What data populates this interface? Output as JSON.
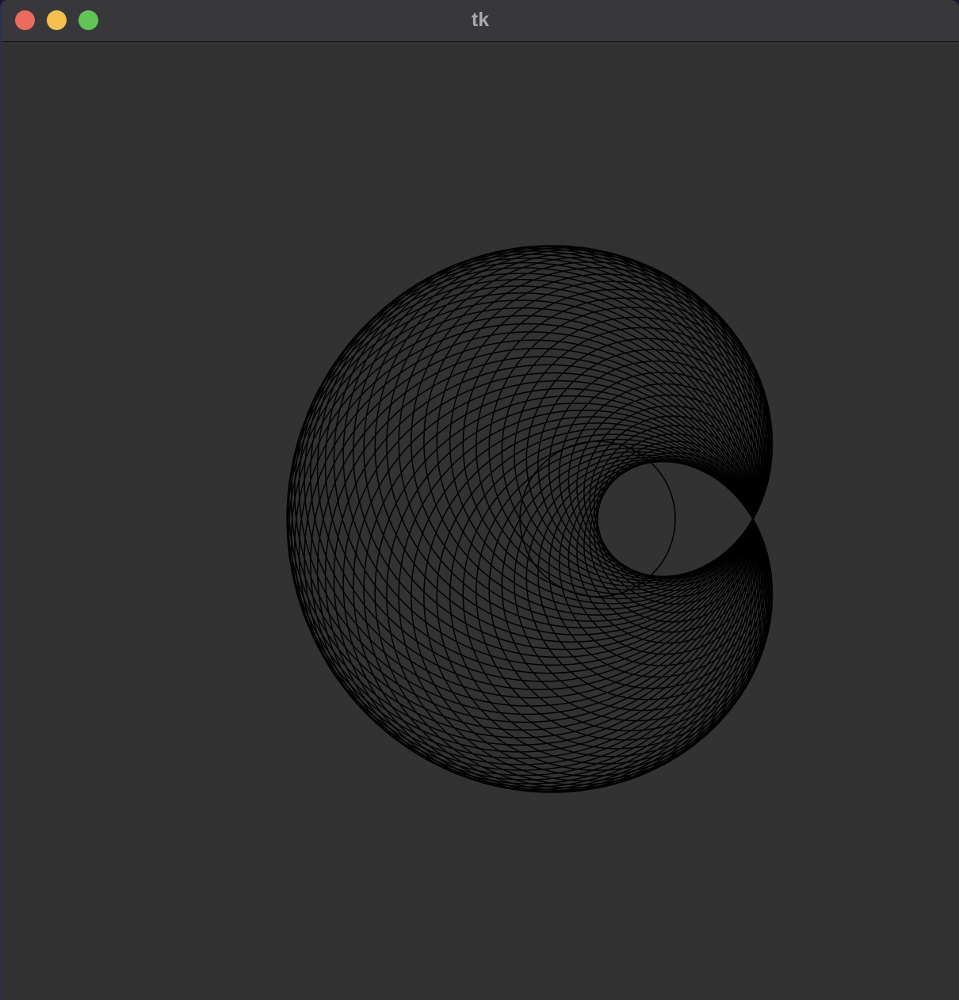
{
  "window": {
    "title": "tk",
    "controls": {
      "close_color": "#ed6a5e",
      "minimize_color": "#f5bf4f",
      "zoom_color": "#61c554"
    }
  },
  "canvas": {
    "background": "#323232",
    "stroke_color": "#000000",
    "figure": "cardioid-envelope-of-circles",
    "circle_count": 72
  }
}
